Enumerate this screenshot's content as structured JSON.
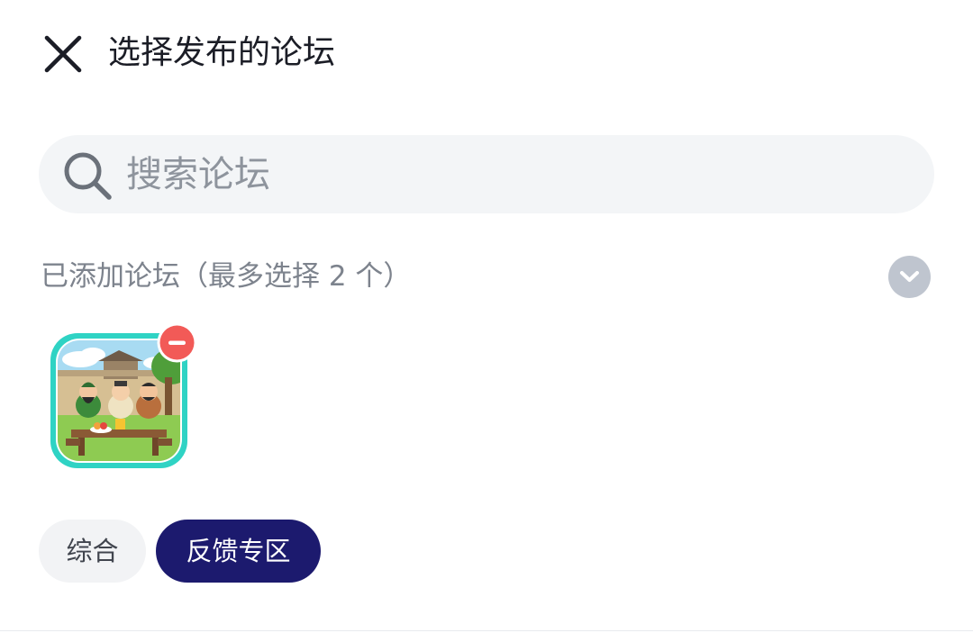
{
  "header": {
    "title": "选择发布的论坛",
    "close_icon": "close-icon"
  },
  "search": {
    "placeholder": "搜索论坛",
    "value": "",
    "icon": "search-icon"
  },
  "added_section": {
    "label": "已添加论坛（最多选择 2 个）",
    "toggle_icon": "chevron-down-icon",
    "forums": [
      {
        "image": "forum-avatar-cartoon-warriors",
        "remove_icon": "minus-circle-icon"
      }
    ]
  },
  "category_tabs": [
    {
      "label": "综合",
      "selected": false
    },
    {
      "label": "反馈专区",
      "selected": true
    }
  ],
  "colors": {
    "text_primary": "#1b1d26",
    "text_secondary": "#7d838d",
    "search_bg": "#f3f5f7",
    "tab_selected_bg": "#1c1a6e",
    "tab_bg": "#f2f3f5",
    "avatar_border": "#2fd3c4",
    "remove_badge": "#f25a57"
  }
}
